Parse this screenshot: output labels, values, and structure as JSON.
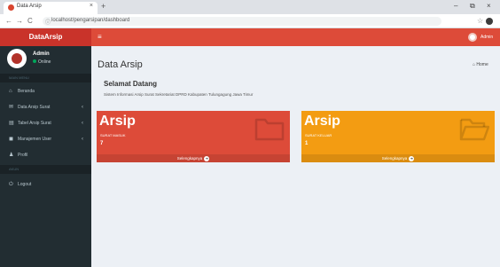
{
  "browser": {
    "tab_title": "Data Arsip",
    "tab_close": "×",
    "new_tab": "+",
    "win_min": "–",
    "win_max": "⧉",
    "win_close": "×",
    "back": "←",
    "forward": "→",
    "reload": "C",
    "url": "localhost/pengarsipan/dashboard",
    "info": "ⓘ",
    "star": "☆"
  },
  "app": {
    "logo": "DataArsip",
    "menu_toggle": "≡",
    "header_user": "Admin"
  },
  "sidebar": {
    "user_name": "Admin",
    "user_status": "Online",
    "header_main": "MAIN MENU",
    "header_account": "AKUN",
    "items": [
      {
        "icon": "⌂",
        "label": "Beranda",
        "chevron": ""
      },
      {
        "icon": "✉",
        "label": "Data Arsip Surat",
        "chevron": "‹"
      },
      {
        "icon": "▤",
        "label": "Tabel Arsip Surat",
        "chevron": "‹"
      },
      {
        "icon": "◼",
        "label": "Manajemen User",
        "chevron": "‹"
      },
      {
        "icon": "♟",
        "label": "Profil",
        "chevron": ""
      }
    ],
    "logout": {
      "icon": "⏻",
      "label": "Logout"
    }
  },
  "content": {
    "page_title": "Data Arsip",
    "breadcrumb": "⌂ Home",
    "welcome_title": "Selamat Datang",
    "welcome_text": "Sistem Informasi Arsip Surat Sekretariat DPRD Kabupaten Tulungagung Jawa Timur",
    "boxes": [
      {
        "title": "Arsip",
        "subtitle": "SURAT MASUK",
        "count": "7",
        "footer": "Selengkapnya",
        "footer_arrow": "➜",
        "color": "#dd4b39",
        "icon": "folder-icon"
      },
      {
        "title": "Arsip",
        "subtitle": "SURAT KELUAR",
        "count": "1",
        "footer": "Selengkapnya",
        "footer_arrow": "➜",
        "color": "#f39c12",
        "icon": "folder-open-icon"
      }
    ]
  },
  "colors": {
    "header": "#dd4b39",
    "logo_bg": "#c9332a",
    "sidebar": "#222d32",
    "content_bg": "#ecf0f5",
    "orange": "#f39c12"
  }
}
